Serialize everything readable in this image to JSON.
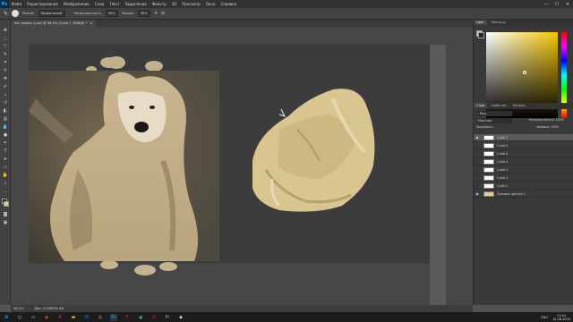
{
  "app": {
    "logo": "Ps"
  },
  "menu": [
    "Файл",
    "Редактирование",
    "Изображение",
    "Слои",
    "Текст",
    "Выделение",
    "Фильтр",
    "3D",
    "Просмотр",
    "Окно",
    "Справка"
  ],
  "window_controls": [
    "—",
    "☐",
    "✕"
  ],
  "options": {
    "mode_label": "Режим:",
    "mode_value": "Нормальный",
    "opacity_label": "Непрозрачность:",
    "opacity_value": "90%",
    "flow_label": "Нажим:",
    "flow_value": "90%"
  },
  "document": {
    "tab_title": "Без имени-1.psd @ 96,5% (Слой 7, RGB/8) *",
    "close": "×"
  },
  "panels": {
    "color_tabs": [
      "Цвет",
      "Образцы"
    ],
    "layers_tabs": [
      "Слои",
      "Свойства",
      "Каналы"
    ],
    "layer_kind": "Вид",
    "blend_mode": "Обычные",
    "opacity_label": "Непрозрачность:",
    "opacity_value": "100%",
    "fill_label": "Заливка:",
    "fill_value": "100%",
    "lock_label": "Закрепить:",
    "layers": [
      {
        "name": "Слой 7",
        "active": true,
        "visible": true
      },
      {
        "name": "Слой 5",
        "active": false,
        "visible": false
      },
      {
        "name": "Слой 6",
        "active": false,
        "visible": false
      },
      {
        "name": "Слой 4",
        "active": false,
        "visible": false
      },
      {
        "name": "Слой 3",
        "active": false,
        "visible": false
      },
      {
        "name": "Слой 2",
        "active": false,
        "visible": false
      },
      {
        "name": "Слой 1",
        "active": false,
        "visible": false
      },
      {
        "name": "Заливка цветом 1",
        "active": false,
        "visible": true
      }
    ]
  },
  "status": {
    "zoom": "96,5%",
    "doc": "Док: 3,95М/35,4М"
  },
  "taskbar": {
    "lang": "ENG",
    "time": "11:54",
    "date": "15.06.2020"
  },
  "colors": {
    "fg": "#2e2a1f",
    "bg": "#e3cf8b",
    "accent": "#31a8ff"
  }
}
